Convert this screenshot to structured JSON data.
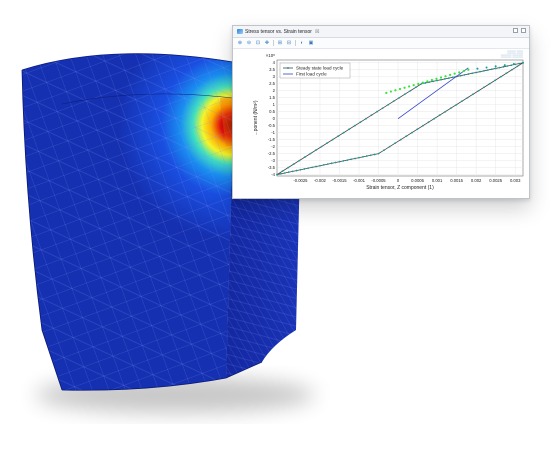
{
  "window": {
    "tab_title": "Stress tensor vs. Strain tensor",
    "tab_close": "☒",
    "toolbar_icons": [
      "zoom-in-icon",
      "zoom-out-icon",
      "zoom-box-icon",
      "zoom-extents-icon",
      "grid-icon",
      "axis-icon",
      "scene-light-icon",
      "camera-icon"
    ]
  },
  "colors": {
    "steady_series": "#444444",
    "steady_markers": "#1a9a9a",
    "first_series": "#3344cc",
    "first_markers": "#33e633",
    "window_border": "#bfc4cc"
  },
  "chart_data": {
    "type": "line",
    "title": "",
    "xlabel": "Strain tensor, Z component (1)",
    "ylabel": "...ponent (N/m²)",
    "y_exponent": "×10⁸",
    "xlim": [
      -0.0031,
      0.0032
    ],
    "ylim": [
      -4.1,
      4.2
    ],
    "x_ticks": [
      -0.0025,
      -0.002,
      -0.0015,
      -0.001,
      -0.0005,
      0,
      0.0005,
      0.001,
      0.0015,
      0.002,
      0.0025,
      0.003
    ],
    "x_tick_labels": [
      "-0.0025",
      "-0.002",
      "-0.0015",
      "-0.001",
      "-0.0005",
      "0",
      "0.0005",
      "0.001",
      "0.0015",
      "0.002",
      "0.0025",
      "0.003"
    ],
    "y_ticks": [
      -4,
      -3.5,
      -3,
      -2.5,
      -2,
      -1.5,
      -1,
      -0.5,
      0,
      0.5,
      1,
      1.5,
      2,
      2.5,
      3,
      3.5,
      4
    ],
    "y_tick_labels": [
      "-4",
      "-3.5",
      "-3",
      "-2.5",
      "-2",
      "-1.5",
      "-1",
      "-0.5",
      "0",
      "0.5",
      "1",
      "1.5",
      "2",
      "2.5",
      "3",
      "3.5",
      "4"
    ],
    "grid": true,
    "legend": {
      "placement": "top-left",
      "entries": [
        "Steady state load cycle",
        "First load cycle"
      ]
    },
    "series": [
      {
        "name": "Steady state load cycle",
        "x": [
          -0.0031,
          -0.0005,
          0.0032,
          0.0006,
          -0.0031
        ],
        "y": [
          -4.0,
          -2.5,
          4.0,
          2.5,
          -4.0
        ]
      },
      {
        "name": "First load cycle",
        "x": [
          0,
          0.0018,
          0.0032
        ],
        "y": [
          0,
          3.5,
          4.0
        ]
      }
    ]
  }
}
